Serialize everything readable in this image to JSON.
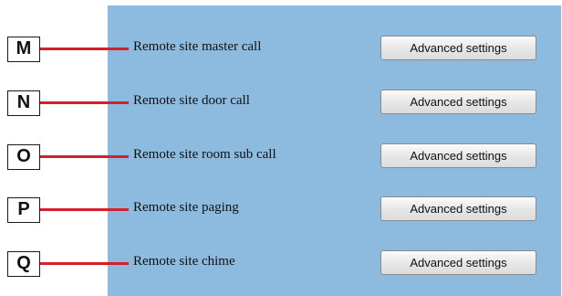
{
  "rows": [
    {
      "marker": "M",
      "label": "Remote site master call",
      "button": "Advanced settings"
    },
    {
      "marker": "N",
      "label": "Remote site door call",
      "button": "Advanced settings"
    },
    {
      "marker": "O",
      "label": "Remote site room sub call",
      "button": "Advanced settings"
    },
    {
      "marker": "P",
      "label": "Remote site paging",
      "button": "Advanced settings"
    },
    {
      "marker": "Q",
      "label": "Remote site chime",
      "button": "Advanced settings"
    }
  ],
  "colors": {
    "panel": "#8dbbe0",
    "leader_line": "#d4202a",
    "button_border": "#8a8a8a"
  }
}
